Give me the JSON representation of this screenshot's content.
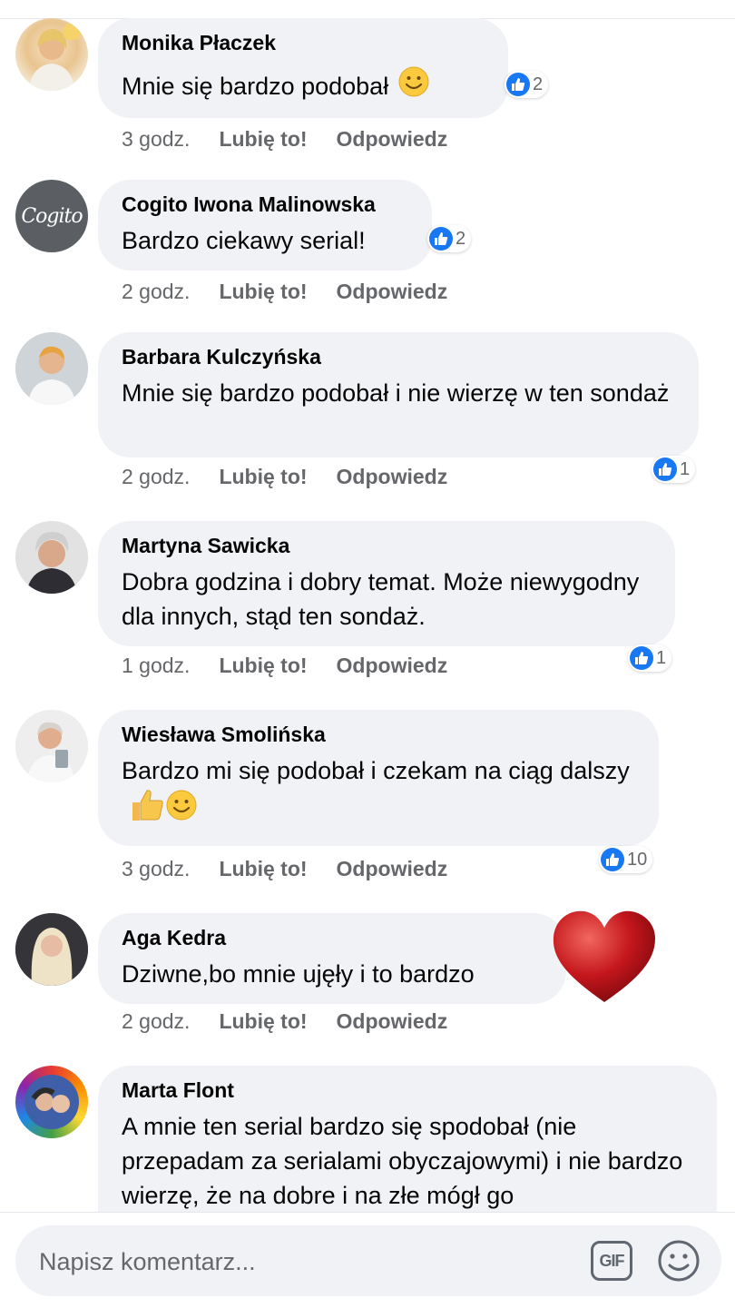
{
  "comments": [
    {
      "author": "Monika Płaczek",
      "text": "Mnie się bardzo podobał",
      "emoji": "smile-emoji",
      "time": "3 godz.",
      "like": "Lubię to!",
      "reply": "Odpowiedz",
      "reactions": "2"
    },
    {
      "author": "Cogito Iwona Malinowska",
      "avatar_text": "Cogito",
      "text": "Bardzo ciekawy serial!",
      "time": "2 godz.",
      "like": "Lubię to!",
      "reply": "Odpowiedz",
      "reactions": "2"
    },
    {
      "author": "Barbara Kulczyńska",
      "text": "Mnie się bardzo podobał i nie wierzę w ten sondaż",
      "time": "2 godz.",
      "like": "Lubię to!",
      "reply": "Odpowiedz",
      "reactions": "1"
    },
    {
      "author": "Martyna Sawicka",
      "text": "Dobra godzina i dobry temat. Może niewygodny dla innych, stąd ten sondaż.",
      "time": "1 godz.",
      "like": "Lubię to!",
      "reply": "Odpowiedz",
      "reactions": "1"
    },
    {
      "author": "Wiesława Smolińska",
      "text": "Bardzo mi się podobał i czekam na ciąg dalszy",
      "emoji": "thumbs-up-and-smile-emoji",
      "time": "3 godz.",
      "like": "Lubię to!",
      "reply": "Odpowiedz",
      "reactions": "10"
    },
    {
      "author": "Aga Kedra",
      "text": "Dziwne,bo mnie ujęły i to bardzo",
      "sticker": "heart-sticker",
      "time": "2 godz.",
      "like": "Lubię to!",
      "reply": "Odpowiedz"
    },
    {
      "author": "Marta Flont",
      "text": "A mnie ten serial bardzo się spodobał (nie przepadam za serialami obyczajowymi) i nie bardzo wierzę, że na dobre i na złe mógł go"
    }
  ],
  "composer": {
    "placeholder": "Napisz komentarz...",
    "gif_label": "GIF",
    "emoji_icon": "smiley-icon"
  },
  "colors": {
    "like_blue": "#1877f2",
    "bubble_bg": "#f0f2f5",
    "meta_gray": "#65676b",
    "heart_red": "#c4161c"
  }
}
